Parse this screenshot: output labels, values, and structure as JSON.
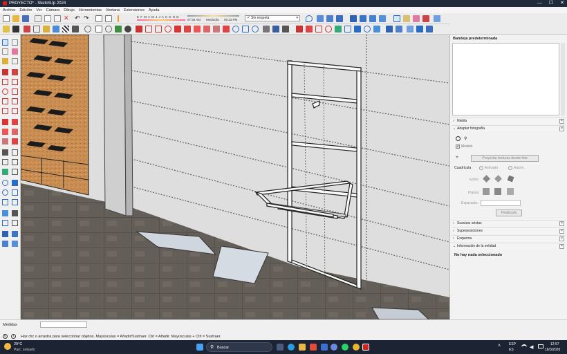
{
  "window": {
    "title": "PROYECTO* - SketchUp 2024",
    "controls": [
      "—",
      "☐",
      "✕"
    ]
  },
  "menu": [
    "Archivo",
    "Edición",
    "Ver",
    "Cámara",
    "Dibujo",
    "Herramientas",
    "Ventana",
    "Extensiones",
    "Ayuda"
  ],
  "shadow_bar": {
    "months": "E F M A M J J A S O N D",
    "time_start": "07:35 AM",
    "midday": "Mediodía",
    "time_end": "05:33 PM"
  },
  "style_dropdown": {
    "value": "Sin esqueta"
  },
  "tray": {
    "title": "Bandeja predeterminada",
    "sections": [
      {
        "label": "Niebla",
        "open": false
      },
      {
        "label": "Adaptar fotografía",
        "open": true
      },
      {
        "label": "Suavizar aristas",
        "open": false
      },
      {
        "label": "Superposiciones",
        "open": false
      },
      {
        "label": "Esquema",
        "open": false
      },
      {
        "label": "Información de la entidad",
        "open": true
      }
    ],
    "photo": {
      "model_label": "Modelo",
      "project_button": "Proyectar texturas desde foto",
      "grid_label": "Cuadrícula",
      "grid_on": "Activado",
      "grid_auto": "Autom.",
      "style_label": "Estilo:",
      "planes_label": "Planos:",
      "spacing_label": "Espaciado:",
      "done_button": "Finalizado"
    },
    "entity_info": "No hay nada seleccionado"
  },
  "status": {
    "measures_label": "Medidas",
    "hint": "Haz clic o arrastra para seleccionar objetos. Mayúsculas = Añadir/Sustraer. Ctrl = Añadir. Mayúsculas + Ctrl = Sustraer."
  },
  "taskbar": {
    "weather_temp": "29°C",
    "weather_desc": "Parc. soleado",
    "search": "Buscar",
    "lang1": "ESP",
    "lang2": "ES",
    "time": "12:57",
    "date": "16/3/2026"
  },
  "colors": {
    "accent": "#1f6fd1",
    "titlebar": "#1f2a3a",
    "taskbar": "#1c2433"
  }
}
